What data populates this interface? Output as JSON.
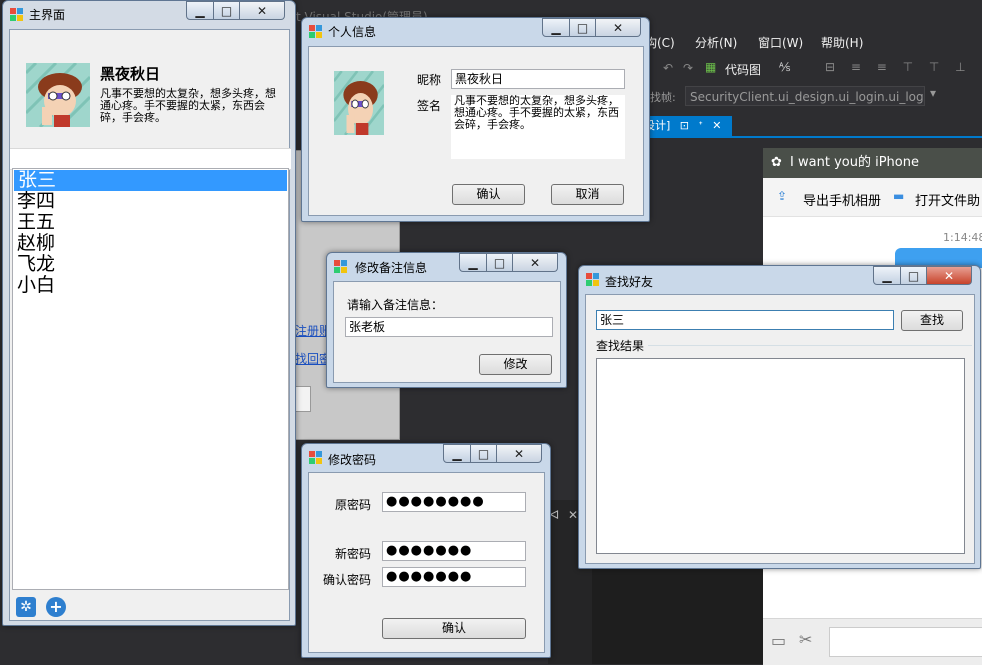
{
  "vs": {
    "title_fragment": "t Visual Studio(管理员)",
    "menu": [
      "构(C)",
      "分析(N)",
      "窗口(W)",
      "帮助(H)"
    ],
    "toolbar": {
      "code_map": "代码图"
    },
    "nav_label": "找帧:",
    "nav_combo": "SecurityClient.ui_design.ui_login.ui_logi",
    "tab_label": "设计]",
    "links": [
      "注册账",
      "找回密"
    ],
    "pane_pin": "ᐊ",
    "pane_close": "✕"
  },
  "qq": {
    "title": "I want you的 iPhone",
    "export_album": "导出手机相册",
    "open_folder": "打开文件助",
    "time": "1:14:48"
  },
  "main_window": {
    "title": "主界面",
    "nickname": "黑夜秋日",
    "signature": "凡事不要想的太复杂，想多头疼，想通心疼。手不要握的太紧，东西会碎，手会疼。",
    "friends": [
      "张三",
      "李四",
      "王五",
      "赵柳",
      "飞龙",
      "小白"
    ],
    "selected_index": 0,
    "buttons": {
      "min": "▁",
      "max": "□",
      "close": "✕"
    }
  },
  "profile_window": {
    "title": "个人信息",
    "nickname_label": "昵称",
    "nickname_value": "黑夜秋日",
    "signature_label": "签名",
    "signature_value": "凡事不要想的太复杂，想多头疼，想通心疼。手不要握的太紧，东西会碎，手会疼。",
    "ok": "确认",
    "cancel": "取消"
  },
  "remark_window": {
    "title": "修改备注信息",
    "prompt": "请输入备注信息：",
    "value": "张老板",
    "submit": "修改"
  },
  "password_window": {
    "title": "修改密码",
    "old_label": "原密码",
    "old_value": "●●●●●●●●",
    "new_label": "新密码",
    "new_value": "●●●●●●●",
    "confirm_label": "确认密码",
    "confirm_value": "●●●●●●●",
    "ok": "确认"
  },
  "search_window": {
    "title": "查找好友",
    "query": "张三",
    "search_button": "查找",
    "results_label": "查找结果"
  },
  "colors": {
    "selection": "#3399ff",
    "vs_accent": "#007acc",
    "window_frame": "#c9d8e9"
  }
}
